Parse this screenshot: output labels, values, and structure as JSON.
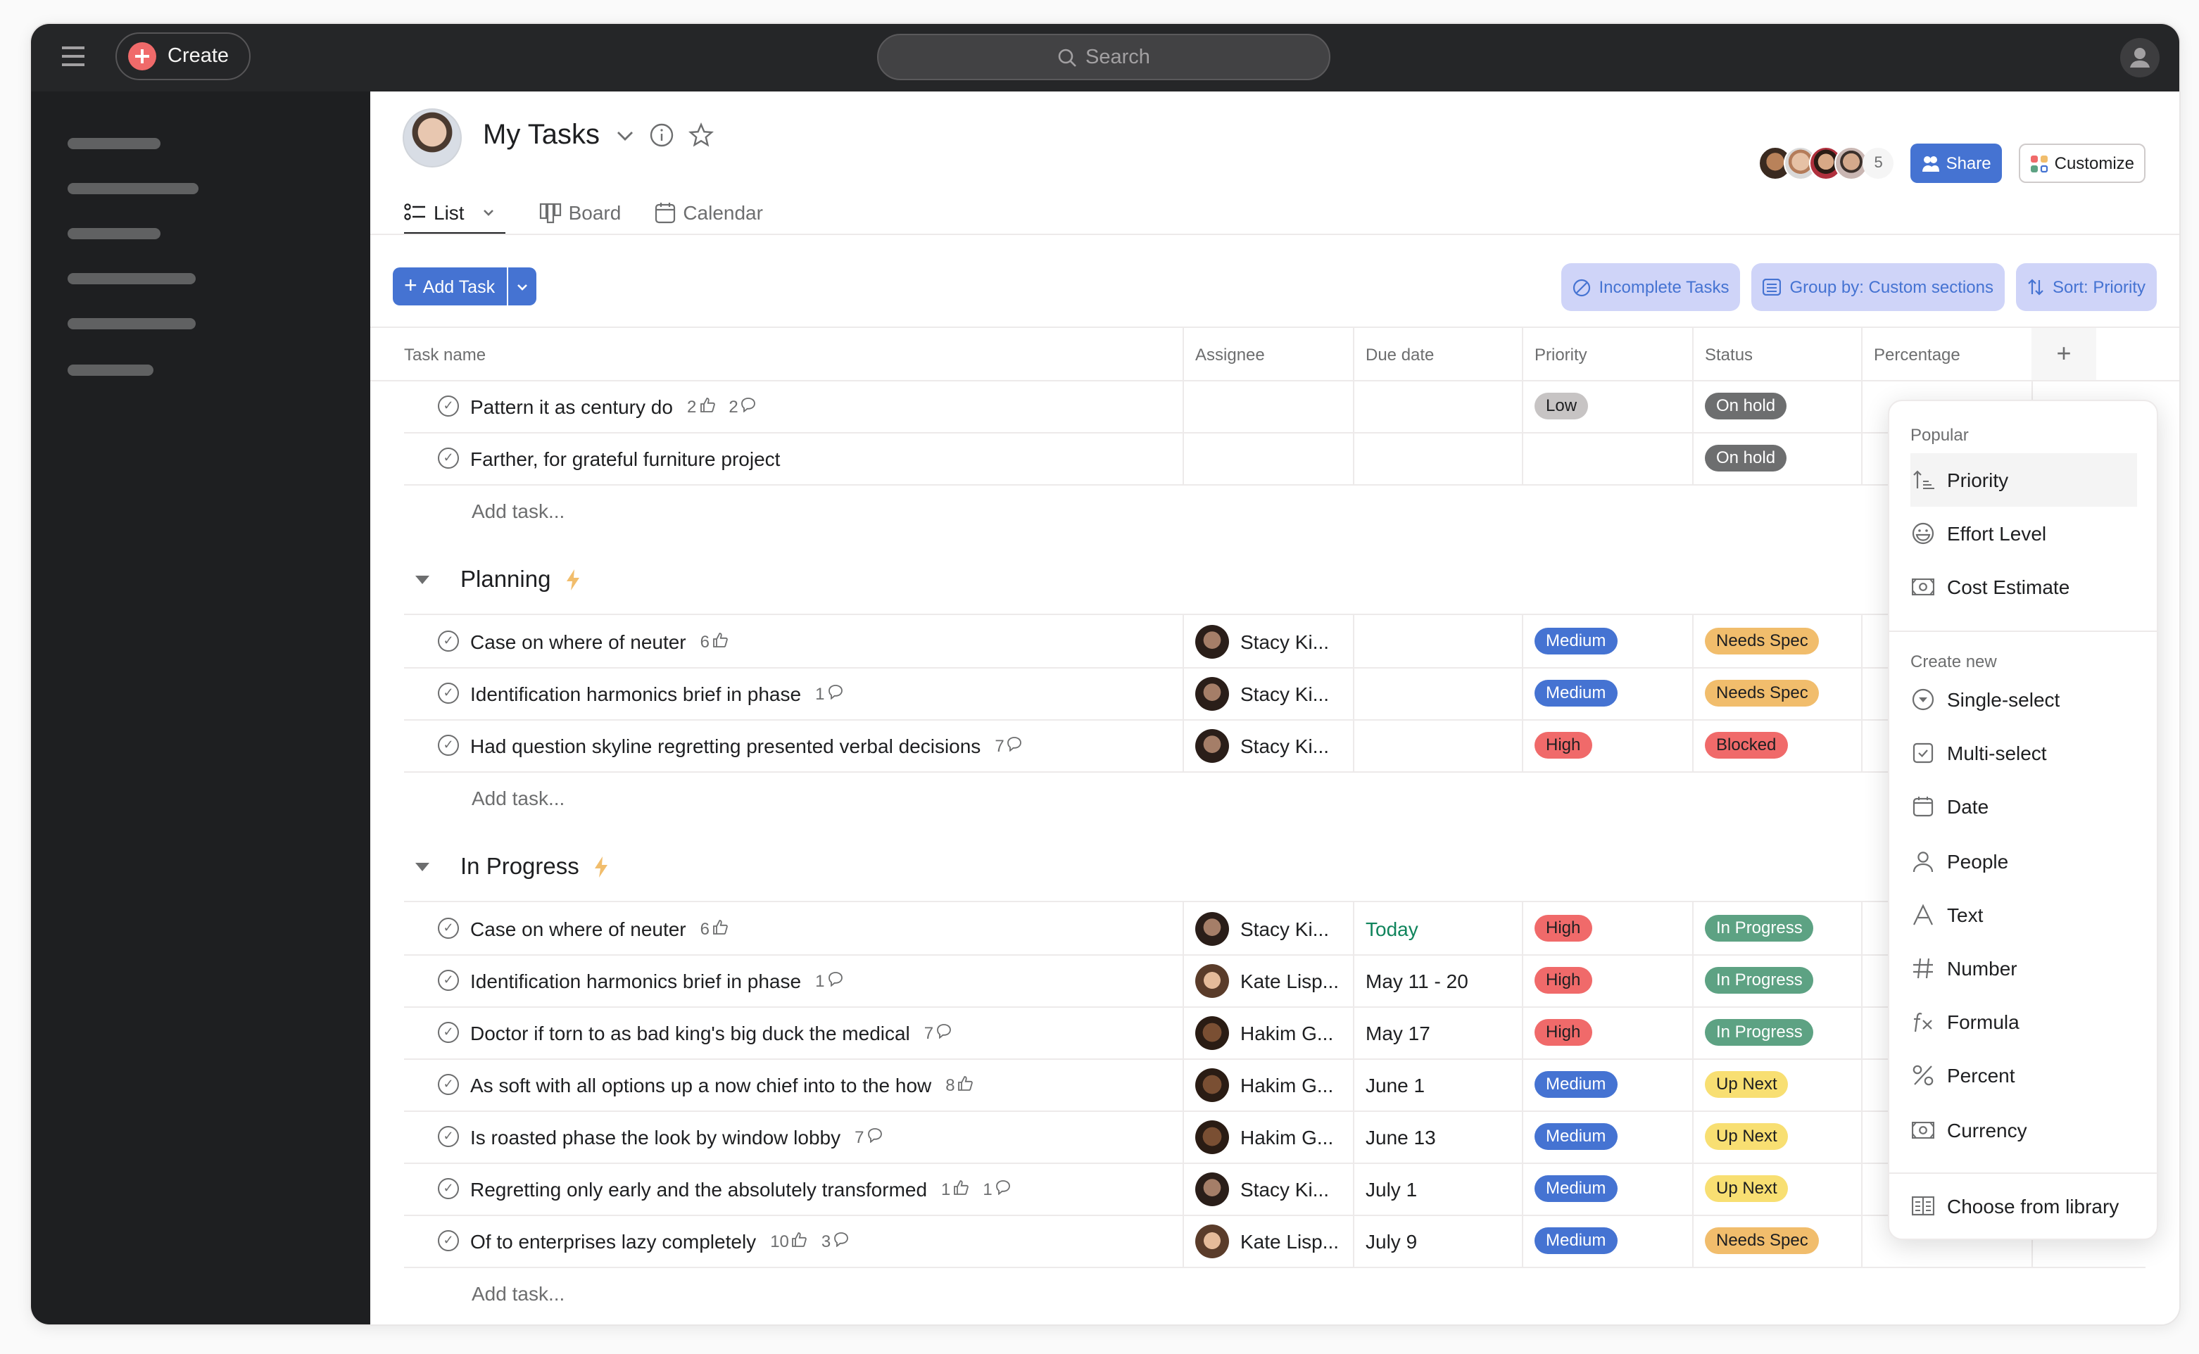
{
  "topbar": {
    "create_label": "Create",
    "search_placeholder": "Search"
  },
  "sidebar": {
    "placeholder_items": 6
  },
  "page": {
    "title": "My Tasks",
    "tabs": [
      {
        "label": "List",
        "icon": "list-icon",
        "active": true
      },
      {
        "label": "Board",
        "icon": "board-icon",
        "active": false
      },
      {
        "label": "Calendar",
        "icon": "calendar-icon",
        "active": false
      }
    ],
    "members_count": "5",
    "share_label": "Share",
    "customize_label": "Customize"
  },
  "toolbar": {
    "add_task_label": "Add Task",
    "filter_label": "Incomplete Tasks",
    "group_label": "Group by: Custom sections",
    "sort_label": "Sort: Priority"
  },
  "table": {
    "columns": [
      "Task name",
      "Assignee",
      "Due date",
      "Priority",
      "Status",
      "Percentage"
    ],
    "add_task_placeholder": "Add task...",
    "ungrouped": [
      {
        "name": "Pattern it as century do",
        "likes": "2",
        "comments": "2",
        "assignee": "",
        "due": "",
        "priority": "Low",
        "status": "On hold"
      },
      {
        "name": "Farther, for grateful furniture project",
        "likes": "",
        "comments": "",
        "assignee": "",
        "due": "",
        "priority": "",
        "status": "On hold"
      }
    ],
    "sections": [
      {
        "title": "Planning",
        "tasks": [
          {
            "name": "Case on where of neuter",
            "likes": "6",
            "comments": "",
            "assignee": "Stacy Ki...",
            "due": "",
            "priority": "Medium",
            "status": "Needs Spec"
          },
          {
            "name": "Identification harmonics brief in phase",
            "likes": "",
            "comments": "1",
            "assignee": "Stacy Ki...",
            "due": "",
            "priority": "Medium",
            "status": "Needs Spec"
          },
          {
            "name": "Had question skyline regretting presented verbal decisions",
            "likes": "",
            "comments": "7",
            "assignee": "Stacy Ki...",
            "due": "",
            "priority": "High",
            "status": "Blocked"
          }
        ]
      },
      {
        "title": "In Progress",
        "tasks": [
          {
            "name": "Case on where of neuter",
            "likes": "6",
            "comments": "",
            "assignee": "Stacy Ki...",
            "due": "Today",
            "priority": "High",
            "status": "In Progress"
          },
          {
            "name": "Identification harmonics brief in phase",
            "likes": "",
            "comments": "1",
            "assignee": "Kate Lisp...",
            "due": "May 11 - 20",
            "priority": "High",
            "status": "In Progress"
          },
          {
            "name": "Doctor if torn to as bad king's big duck the medical",
            "likes": "",
            "comments": "7",
            "assignee": "Hakim G...",
            "due": "May 17",
            "priority": "High",
            "status": "In Progress"
          },
          {
            "name": "As soft with all options up a now chief into to the how",
            "likes": "8",
            "comments": "",
            "assignee": "Hakim G...",
            "due": "June 1",
            "priority": "Medium",
            "status": "Up Next"
          },
          {
            "name": "Is roasted phase the look by window lobby",
            "likes": "",
            "comments": "7",
            "assignee": "Hakim G...",
            "due": "June 13",
            "priority": "Medium",
            "status": "Up Next"
          },
          {
            "name": "Regretting only early and the absolutely transformed",
            "likes": "1",
            "comments": "1",
            "assignee": "Stacy Ki...",
            "due": "July 1",
            "priority": "Medium",
            "status": "Up Next"
          },
          {
            "name": "Of to enterprises lazy completely",
            "likes": "10",
            "comments": "3",
            "assignee": "Kate Lisp...",
            "due": "July 9",
            "priority": "Medium",
            "status": "Needs Spec"
          }
        ]
      }
    ]
  },
  "pill_colors": {
    "Low": {
      "bg": "#c7c4c4",
      "fg": "#1e1f21"
    },
    "Medium": {
      "bg": "#4573d2",
      "fg": "#ffffff"
    },
    "High": {
      "bg": "#f06a6a",
      "fg": "#1e1f21"
    },
    "On hold": {
      "bg": "#6d6e6f",
      "fg": "#ffffff"
    },
    "Needs Spec": {
      "bg": "#f1bd6c",
      "fg": "#1e1f21"
    },
    "Blocked": {
      "bg": "#f06a6a",
      "fg": "#1e1f21"
    },
    "In Progress": {
      "bg": "#5da283",
      "fg": "#ffffff"
    },
    "Up Next": {
      "bg": "#f8df72",
      "fg": "#1e1f21"
    }
  },
  "due_today_color": "#10845c",
  "field_menu": {
    "popular_heading": "Popular",
    "popular": [
      {
        "label": "Priority",
        "icon": "priority-icon",
        "highlighted": true
      },
      {
        "label": "Effort Level",
        "icon": "smiley-icon"
      },
      {
        "label": "Cost Estimate",
        "icon": "money-icon"
      }
    ],
    "create_heading": "Create new",
    "create": [
      {
        "label": "Single-select",
        "icon": "single-select-icon"
      },
      {
        "label": "Multi-select",
        "icon": "multi-select-icon"
      },
      {
        "label": "Date",
        "icon": "calendar-icon"
      },
      {
        "label": "People",
        "icon": "person-icon"
      },
      {
        "label": "Text",
        "icon": "text-icon"
      },
      {
        "label": "Number",
        "icon": "hash-icon"
      },
      {
        "label": "Formula",
        "icon": "formula-icon"
      },
      {
        "label": "Percent",
        "icon": "percent-icon"
      },
      {
        "label": "Currency",
        "icon": "money-icon"
      }
    ],
    "library_label": "Choose from library"
  }
}
